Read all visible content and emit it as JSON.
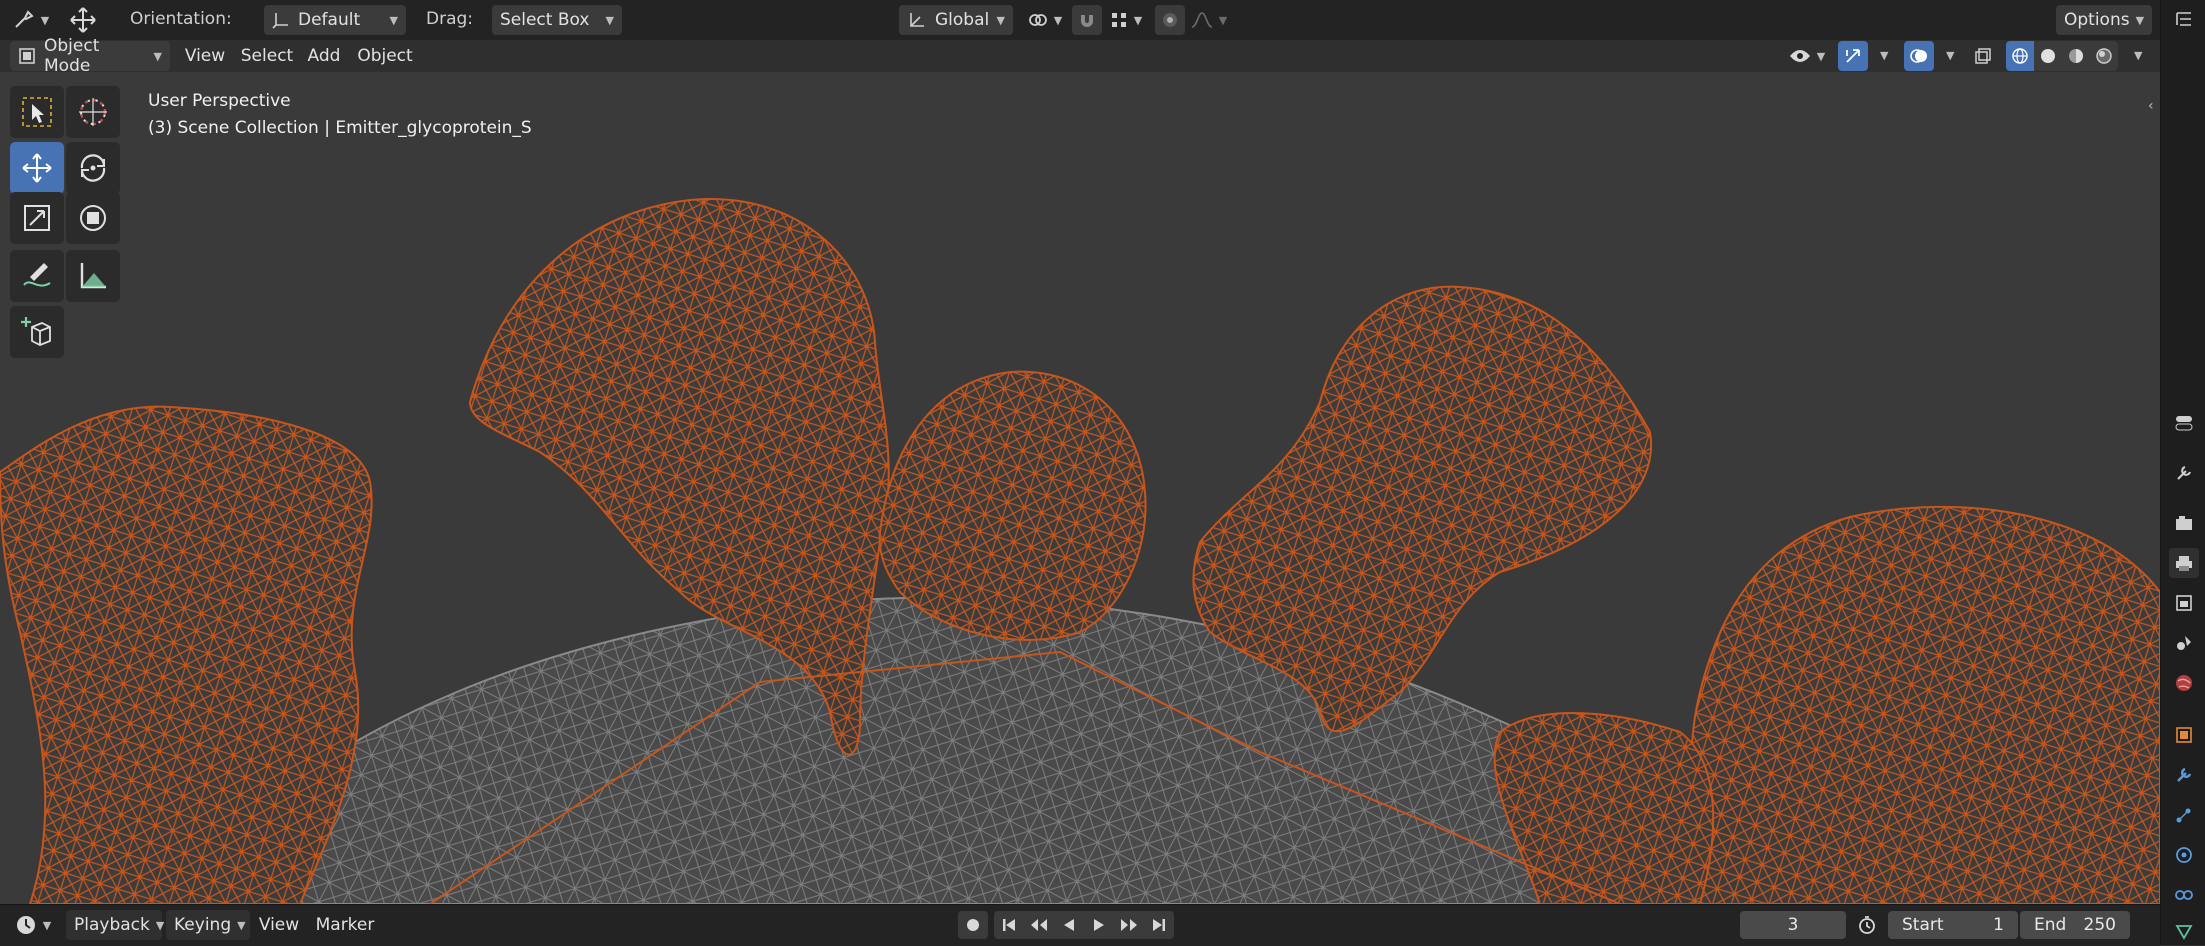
{
  "header": {
    "orientation_label": "Orientation:",
    "orientation_value": "Default",
    "drag_label": "Drag:",
    "drag_value": "Select Box",
    "transform_orientation": "Global",
    "options_label": "Options"
  },
  "mode_bar": {
    "mode": "Object Mode",
    "menus": [
      "View",
      "Select",
      "Add",
      "Object"
    ]
  },
  "viewport": {
    "perspective_text": "User Perspective",
    "collection_text": "(3) Scene Collection | Emitter_glycoprotein_S",
    "selected_wire_color": "#c8561c",
    "mesh_wire_color": "#8a8a8a",
    "background_color": "#3a3a3a"
  },
  "toolbar": {
    "tools": [
      "select-box",
      "cursor",
      "move",
      "rotate",
      "scale",
      "transform",
      "annotate",
      "measure",
      "add-cube"
    ],
    "active": "move"
  },
  "timeline": {
    "menus": [
      "Playback",
      "Keying",
      "View",
      "Marker"
    ],
    "current_frame": "3",
    "start_label": "Start",
    "start_value": "1",
    "end_label": "End",
    "end_value": "250"
  },
  "colors": {
    "accent": "#4772b3",
    "header_bg": "#232323",
    "panel_bg": "#303030"
  }
}
